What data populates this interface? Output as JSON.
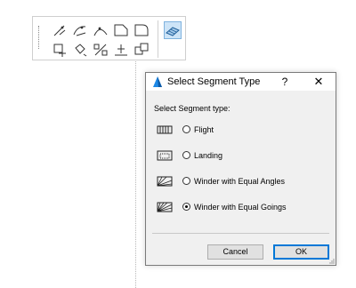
{
  "palette": {
    "tools": [
      {
        "icon": "line-node-icon"
      },
      {
        "icon": "arc-node-icon"
      },
      {
        "icon": "curve-node-icon"
      },
      {
        "icon": "chamfer-corner-icon"
      },
      {
        "icon": "fillet-corner-icon"
      },
      {
        "icon": "segment-type-icon",
        "active": true
      },
      {
        "icon": "move-node-icon"
      },
      {
        "icon": "rotate-shape-icon"
      },
      {
        "icon": "split-segment-icon"
      },
      {
        "icon": "align-segment-icon"
      },
      {
        "icon": "duplicate-shape-icon"
      }
    ]
  },
  "dialog": {
    "title": "Select Segment Type",
    "help_label": "?",
    "close_label": "✕",
    "section_label": "Select Segment type:",
    "options": [
      {
        "label": "Flight",
        "icon": "flight-icon",
        "selected": false
      },
      {
        "label": "Landing",
        "icon": "landing-icon",
        "selected": false
      },
      {
        "label": "Winder with Equal Angles",
        "icon": "winder-equal-angles-icon",
        "selected": false
      },
      {
        "label": "Winder with Equal Goings",
        "icon": "winder-equal-goings-icon",
        "selected": true
      }
    ],
    "cancel_label": "Cancel",
    "ok_label": "OK"
  },
  "colors": {
    "accent": "#0078d7",
    "dialog_bg": "#f0f0f0",
    "titlebar_bg": "#ffffff",
    "active_tool_bg": "#cde4f7"
  }
}
